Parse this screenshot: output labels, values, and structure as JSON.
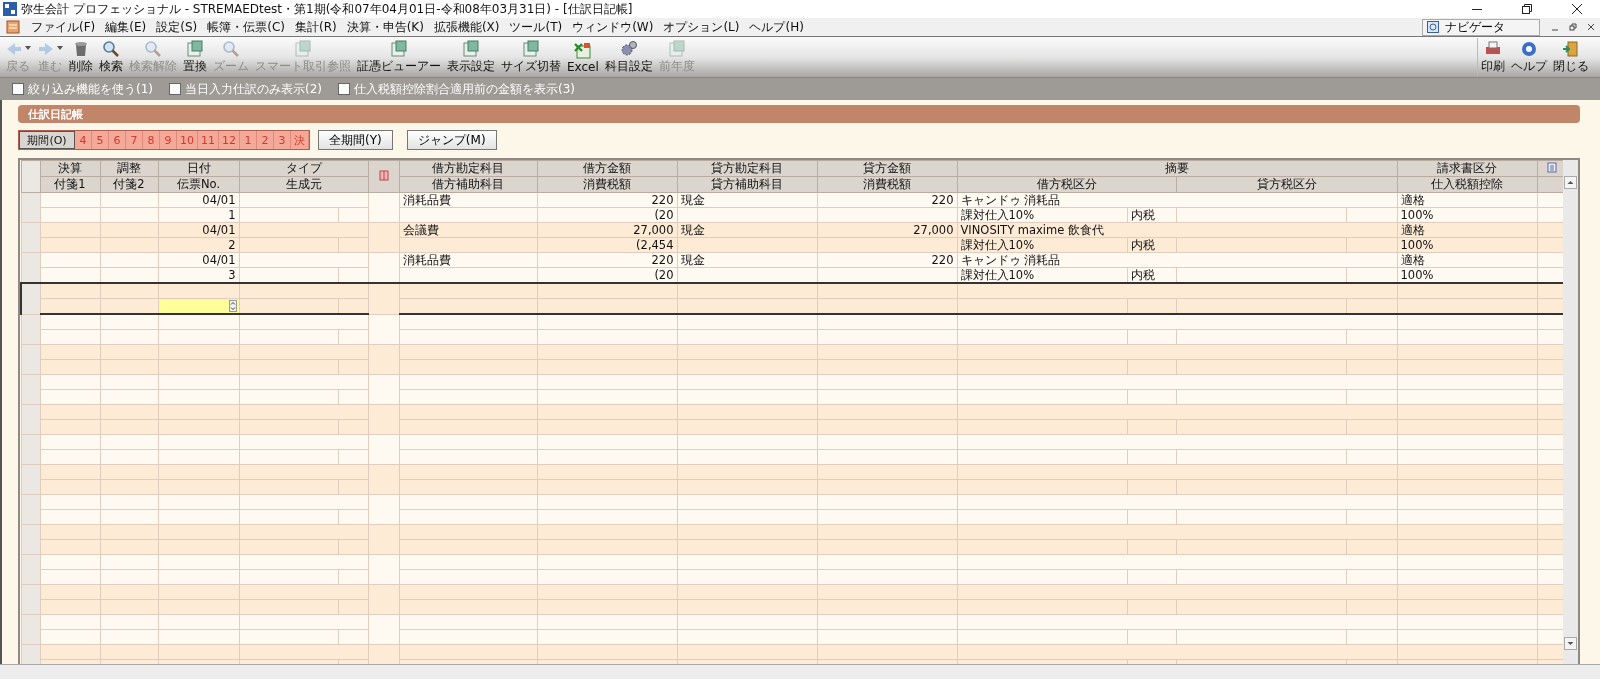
{
  "window": {
    "title": "弥生会計 プロフェッショナル - STREMAEDtest・第1期(令和07年04月01日-令和08年03月31日) - [仕訳日記帳]"
  },
  "menu": [
    "ファイル(F)",
    "編集(E)",
    "設定(S)",
    "帳簿・伝票(C)",
    "集計(R)",
    "決算・申告(K)",
    "拡張機能(X)",
    "ツール(T)",
    "ウィンドウ(W)",
    "オプション(L)",
    "ヘルプ(H)"
  ],
  "navigator": {
    "label": "ナビゲータ"
  },
  "toolbar": [
    {
      "label": "戻る",
      "disabled": true,
      "dropdown": true
    },
    {
      "label": "進む",
      "disabled": true,
      "dropdown": true
    },
    {
      "label": "削除",
      "disabled": false,
      "dropdown": false
    },
    {
      "label": "検索",
      "disabled": false,
      "dropdown": false
    },
    {
      "label": "検索解除",
      "disabled": true,
      "dropdown": false
    },
    {
      "label": "置換",
      "disabled": false,
      "dropdown": false
    },
    {
      "label": "ズーム",
      "disabled": true,
      "dropdown": false
    },
    {
      "label": "スマート取引参照",
      "disabled": true,
      "dropdown": false
    },
    {
      "label": "証憑ビューアー",
      "disabled": false,
      "dropdown": false
    },
    {
      "label": "表示設定",
      "disabled": false,
      "dropdown": false
    },
    {
      "label": "サイズ切替",
      "disabled": false,
      "dropdown": false
    },
    {
      "label": "Excel",
      "disabled": false,
      "dropdown": false
    },
    {
      "label": "科目設定",
      "disabled": false,
      "dropdown": false
    },
    {
      "label": "前年度",
      "disabled": true,
      "dropdown": false
    }
  ],
  "toolbar_right": [
    {
      "label": "印刷"
    },
    {
      "label": "ヘルプ"
    },
    {
      "label": "閉じる"
    }
  ],
  "options": [
    {
      "label": "絞り込み機能を使う(1)",
      "checked": false
    },
    {
      "label": "当日入力仕訳のみ表示(2)",
      "checked": false
    },
    {
      "label": "仕入税額控除割合適用前の金額を表示(3)",
      "checked": false
    }
  ],
  "panel": {
    "title": "仕訳日記帳"
  },
  "periods": [
    {
      "label": "期間(O)",
      "selected": true
    },
    {
      "label": "4",
      "selected": false
    },
    {
      "label": "5",
      "selected": false
    },
    {
      "label": "6",
      "selected": false
    },
    {
      "label": "7",
      "selected": false
    },
    {
      "label": "8",
      "selected": false
    },
    {
      "label": "9",
      "selected": false
    },
    {
      "label": "10",
      "selected": false
    },
    {
      "label": "11",
      "selected": false
    },
    {
      "label": "12",
      "selected": false
    },
    {
      "label": "1",
      "selected": false
    },
    {
      "label": "2",
      "selected": false
    },
    {
      "label": "3",
      "selected": false
    },
    {
      "label": "決",
      "selected": false
    }
  ],
  "period_buttons": [
    "全期間(Y)",
    "ジャンプ(M)"
  ],
  "table": {
    "header_top": [
      "決算",
      "調整",
      "日付",
      "タイプ",
      "借方勘定科目",
      "借方金額",
      "貸方勘定科目",
      "貸方金額",
      "摘要",
      "請求書区分"
    ],
    "header_bottom": [
      "付箋1",
      "付箋2",
      "伝票No.",
      "生成元",
      "借方補助科目",
      "消費税額",
      "貸方補助科目",
      "消費税額",
      "借方税区分",
      "貸方税区分",
      "仕入税額控除"
    ],
    "entries": [
      {
        "date": "04/01",
        "slip_no": "1",
        "debit_account": "消耗品費",
        "debit_amount": "220",
        "debit_tax": "(20",
        "credit_account": "現金",
        "credit_amount": "220",
        "memo": "キャンドゥ 消耗品",
        "debit_tax_class": "課対仕入10%",
        "debit_tax_mode": "内税",
        "invoice": "適格",
        "deduction": "100%"
      },
      {
        "date": "04/01",
        "slip_no": "2",
        "debit_account": "会議費",
        "debit_amount": "27,000",
        "debit_tax": "(2,454",
        "credit_account": "現金",
        "credit_amount": "27,000",
        "memo": "VINOSITY maxime 飲食代",
        "debit_tax_class": "課対仕入10%",
        "debit_tax_mode": "内税",
        "invoice": "適格",
        "deduction": "100%"
      },
      {
        "date": "04/01",
        "slip_no": "3",
        "debit_account": "消耗品費",
        "debit_amount": "220",
        "debit_tax": "(20",
        "credit_account": "現金",
        "credit_amount": "220",
        "memo": "キャンドゥ 消耗品",
        "debit_tax_class": "課対仕入10%",
        "debit_tax_mode": "内税",
        "invoice": "適格",
        "deduction": "100%"
      }
    ]
  }
}
